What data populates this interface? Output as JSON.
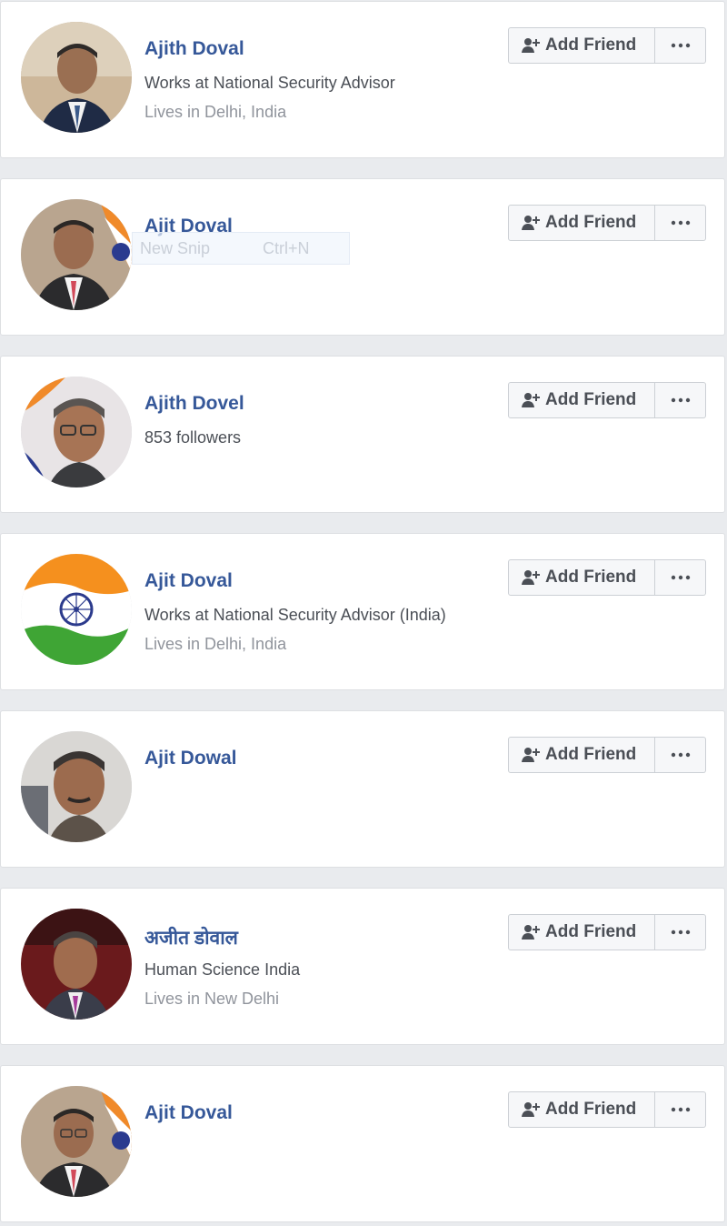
{
  "results": [
    {
      "name": "Ajith Doval",
      "line1": "Works at National Security Advisor",
      "line2": "Lives in Delhi, India",
      "add_label": "Add Friend",
      "avatar": "person-photo"
    },
    {
      "name": "Ajit Doval",
      "line1": "",
      "line2": "",
      "add_label": "Add Friend",
      "avatar": "person-photo"
    },
    {
      "name": "Ajith Dovel",
      "line1": "853 followers",
      "line2": "",
      "add_label": "Add Friend",
      "avatar": "person-photo"
    },
    {
      "name": "Ajit Doval",
      "line1": "Works at National Security Advisor (India)",
      "line2": "Lives in Delhi, India",
      "add_label": "Add Friend",
      "avatar": "india-flag"
    },
    {
      "name": "Ajit Dowal",
      "line1": "",
      "line2": "",
      "add_label": "Add Friend",
      "avatar": "person-photo"
    },
    {
      "name": "अजीत डोवाल",
      "line1": "Human Science India",
      "line2": "Lives in New Delhi",
      "add_label": "Add Friend",
      "avatar": "person-photo"
    },
    {
      "name": "Ajit Doval",
      "line1": "",
      "line2": "",
      "add_label": "Add Friend",
      "avatar": "person-photo"
    }
  ],
  "overlay": {
    "snip_label": "New Snip",
    "snip_shortcut": "Ctrl+N"
  },
  "colors": {
    "name_link": "#365899",
    "background": "#e9ebee",
    "button_bg": "#f6f7f9"
  }
}
